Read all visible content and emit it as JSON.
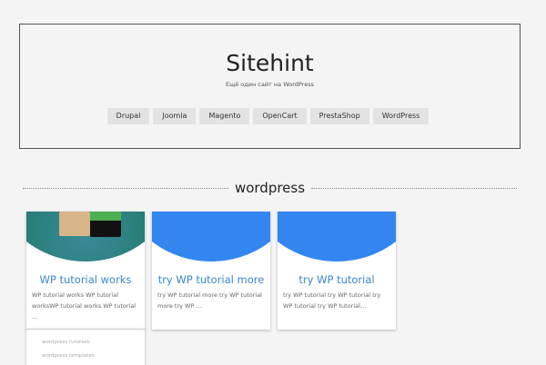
{
  "site": {
    "title": "Sitehint",
    "tagline": "Ещё один сайт на WordPress"
  },
  "nav": [
    "Drupal",
    "Joomla",
    "Magento",
    "OpenCart",
    "PrestaShop",
    "WordPress"
  ],
  "section": {
    "title": "wordpress"
  },
  "posts": [
    {
      "title": "WP tutorial works",
      "excerpt": "WP tutorial works WP tutorial worksWP tutorial works WP tutorial …"
    },
    {
      "title": "try WP tutorial more",
      "excerpt": "try WP tutorial more try WP tutorial more try WP …"
    },
    {
      "title": "try WP tutorial",
      "excerpt": "try WP tutorial try WP tutorial try WP tutorial try WP tutorial…"
    }
  ],
  "tags": [
    "wordpress tutorials",
    "wordpress templates"
  ],
  "colors": {
    "accent": "#3386f0",
    "link": "#3a85d0"
  }
}
